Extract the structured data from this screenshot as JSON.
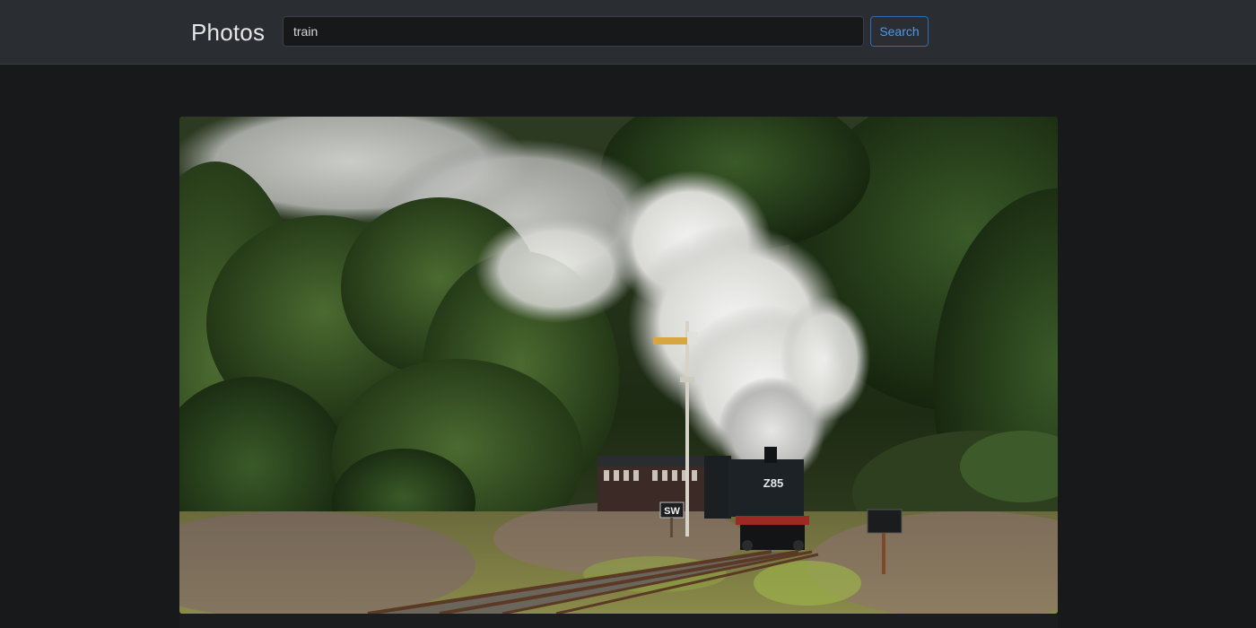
{
  "navbar": {
    "brand": "Photos",
    "search": {
      "value": "train",
      "placeholder": "Search"
    },
    "search_button_label": "Search",
    "accent_color": "#4a9bf0"
  },
  "results": [
    {
      "alt": "Steam locomotive on a countryside railway",
      "locomotive_number": "Z85",
      "signal_plate": "SW"
    }
  ]
}
